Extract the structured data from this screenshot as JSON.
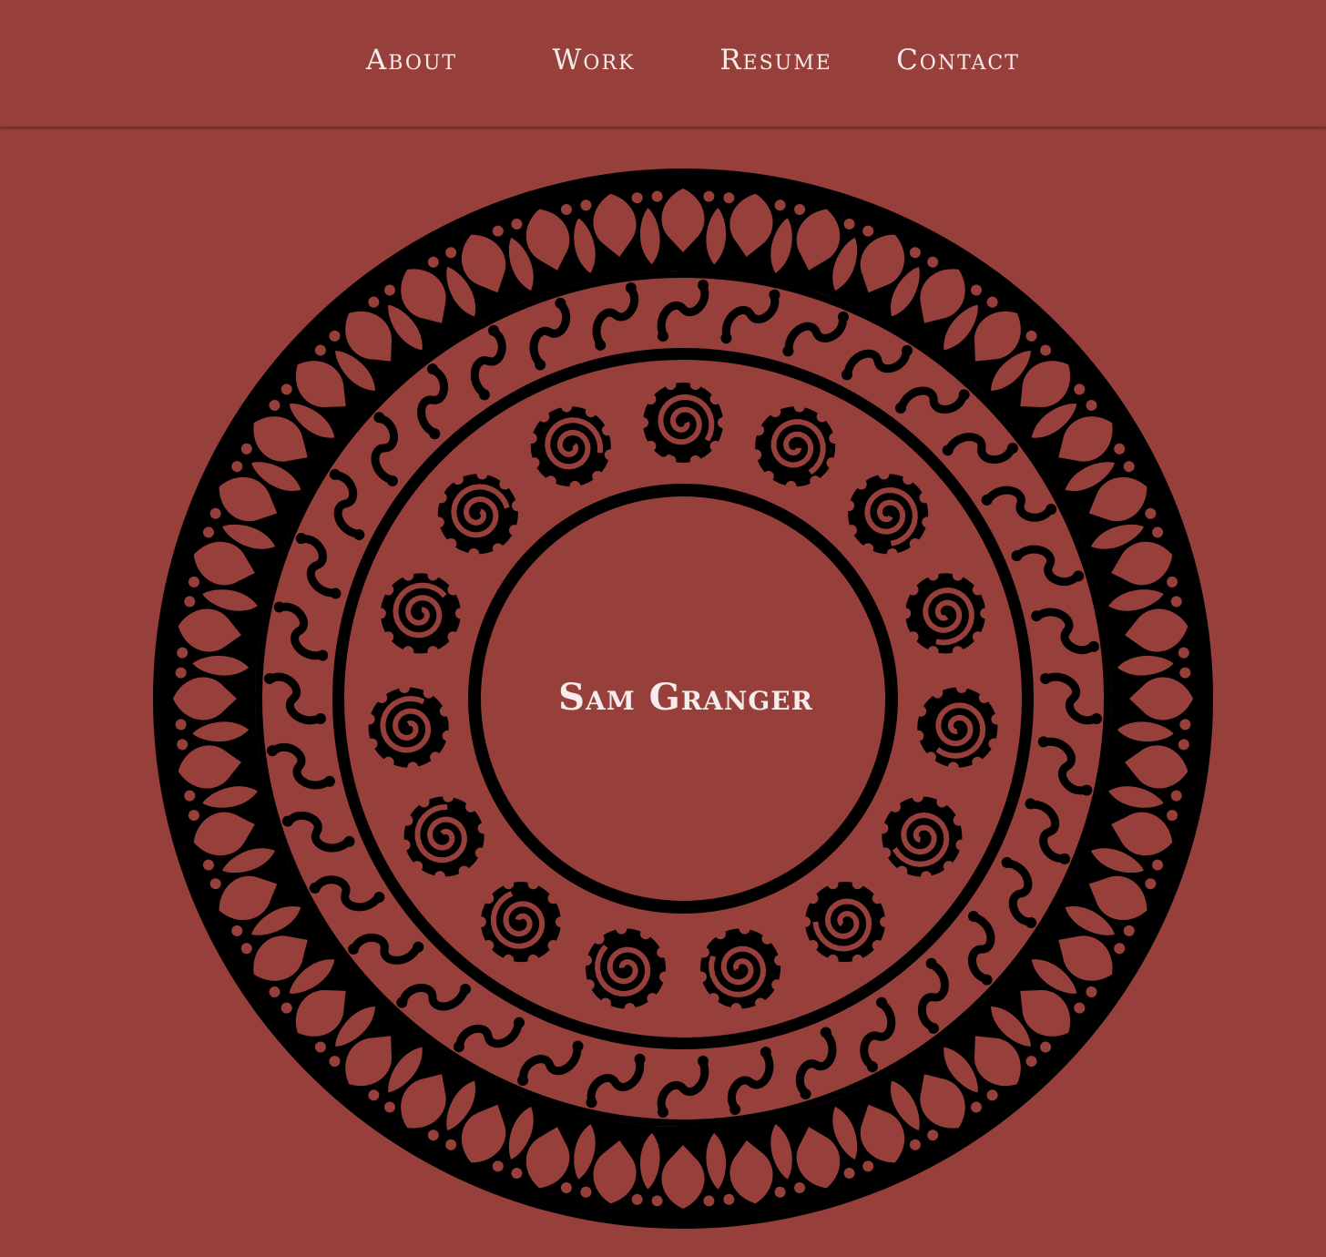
{
  "nav": {
    "items": [
      {
        "label": "About"
      },
      {
        "label": "Work"
      },
      {
        "label": "Resume"
      },
      {
        "label": "Contact"
      }
    ]
  },
  "hero": {
    "name": "Sam Granger"
  },
  "colors": {
    "background": "#97403b",
    "text": "#f6eceb",
    "ornament": "#000000"
  },
  "ornament": {
    "icon": "circular-arabesque-emblem",
    "outer_band_motifs": 44,
    "middle_band_motifs": 36,
    "spiral_count": 15
  }
}
